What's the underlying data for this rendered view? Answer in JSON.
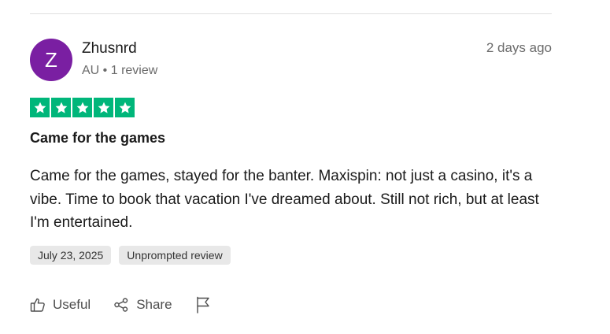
{
  "review": {
    "reviewer": {
      "initial": "Z",
      "name": "Zhusnrd",
      "meta": "AU • 1 review",
      "avatar_color": "#7a1fa2"
    },
    "posted_ago": "2 days ago",
    "rating": 5,
    "rating_max": 5,
    "star_color": "#00b67a",
    "title": "Came for the games",
    "body": "Came for the games, stayed for the banter. Maxispin: not just a casino, it's a vibe. Time to book that vacation I've dreamed about. Still not rich, but at least I'm entertained.",
    "tags": {
      "date": "July 23, 2025",
      "type": "Unprompted review"
    },
    "actions": {
      "useful_label": "Useful",
      "useful_icon": "thumbs-up-icon",
      "share_label": "Share",
      "share_icon": "share-icon",
      "report_icon": "flag-icon"
    }
  }
}
